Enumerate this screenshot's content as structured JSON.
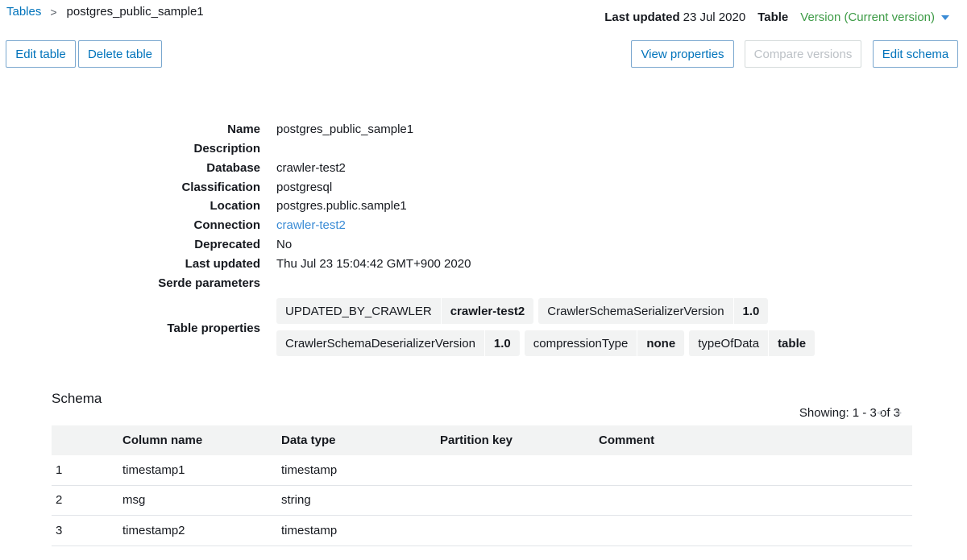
{
  "breadcrumb": {
    "root": "Tables",
    "separator": ">",
    "current": "postgres_public_sample1"
  },
  "header": {
    "last_updated_label": "Last updated",
    "last_updated_value": "23 Jul 2020",
    "table_label": "Table",
    "version_label": "Version (Current version)"
  },
  "toolbar": {
    "edit_table": "Edit table",
    "delete_table": "Delete table",
    "view_properties": "View properties",
    "compare_versions": "Compare versions",
    "edit_schema": "Edit schema"
  },
  "details": [
    {
      "label": "Name",
      "value": "postgres_public_sample1"
    },
    {
      "label": "Description",
      "value": ""
    },
    {
      "label": "Database",
      "value": "crawler-test2"
    },
    {
      "label": "Classification",
      "value": "postgresql"
    },
    {
      "label": "Location",
      "value": "postgres.public.sample1"
    },
    {
      "label": "Connection",
      "value": "crawler-test2"
    },
    {
      "label": "Deprecated",
      "value": "No"
    },
    {
      "label": "Last updated",
      "value": "Thu Jul 23 15:04:42 GMT+900 2020"
    },
    {
      "label": "Serde parameters",
      "value": ""
    }
  ],
  "table_properties": {
    "label": "Table properties",
    "rows": [
      [
        {
          "key": "UPDATED_BY_CRAWLER",
          "value": "crawler-test2"
        },
        {
          "key": "CrawlerSchemaSerializerVersion",
          "value": "1.0"
        }
      ],
      [
        {
          "key": "CrawlerSchemaDeserializerVersion",
          "value": "1.0"
        },
        {
          "key": "compressionType",
          "value": "none"
        },
        {
          "key": "typeOfData",
          "value": "table"
        }
      ]
    ]
  },
  "schema": {
    "title": "Schema",
    "showing": "Showing: 1 - 3 of 3",
    "pager_prev": "<",
    "pager_next": ">",
    "columns": [
      "",
      "Column name",
      "Data type",
      "Partition key",
      "Comment"
    ],
    "rows": [
      [
        "1",
        "timestamp1",
        "timestamp",
        "",
        ""
      ],
      [
        "2",
        "msg",
        "string",
        "",
        ""
      ],
      [
        "3",
        "timestamp2",
        "timestamp",
        "",
        ""
      ]
    ]
  },
  "colors": {
    "link": "#0073bb",
    "version_green": "#3d9b46",
    "button_border": "#7aa7cf",
    "disabled_text": "#bcc1c6",
    "header_bg": "#f2f3f3"
  }
}
